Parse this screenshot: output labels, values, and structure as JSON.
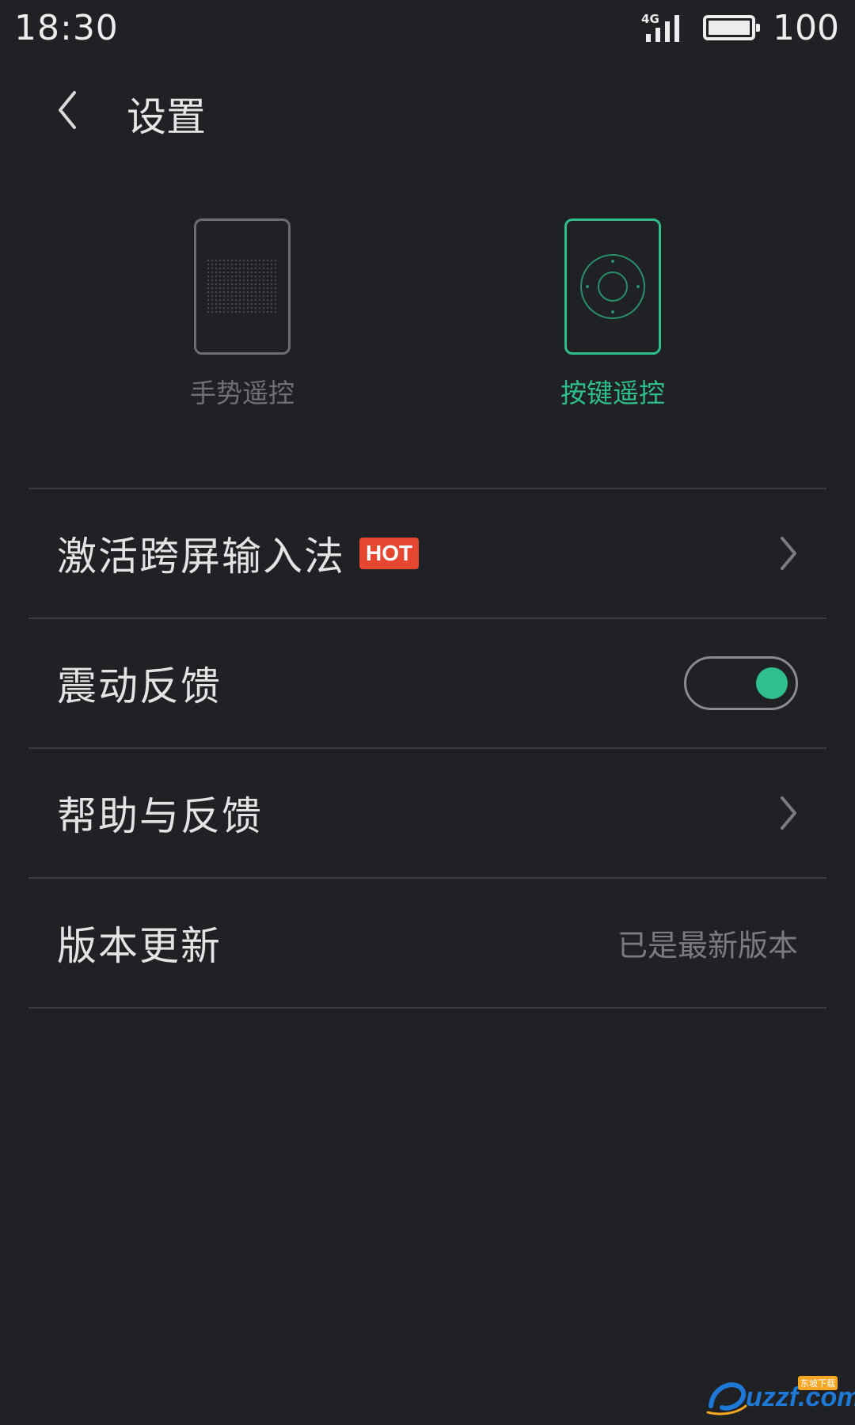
{
  "status_bar": {
    "time": "18:30",
    "network": "4G",
    "battery_level": "100",
    "icons": [
      "signal-icon",
      "battery-icon"
    ]
  },
  "header": {
    "title": "设置",
    "back_icon": "chevron-left-icon"
  },
  "modes": [
    {
      "label": "手势遥控",
      "icon": "touchpad-icon",
      "selected": false
    },
    {
      "label": "按键遥控",
      "icon": "dpad-remote-icon",
      "selected": true
    }
  ],
  "settings": {
    "activate_ime": {
      "label": "激活跨屏输入法",
      "badge": "HOT"
    },
    "vibration": {
      "label": "震动反馈",
      "enabled": true
    },
    "help": {
      "label": "帮助与反馈"
    },
    "update": {
      "label": "版本更新",
      "value": "已是最新版本"
    }
  },
  "watermark": {
    "text": "uzzf.com",
    "tag": "东坡下载"
  },
  "colors": {
    "background": "#202125",
    "accent": "#2fbf8f",
    "hot_badge": "#e5462f",
    "divider": "#3a3b40",
    "muted_text": "#6f7075"
  }
}
